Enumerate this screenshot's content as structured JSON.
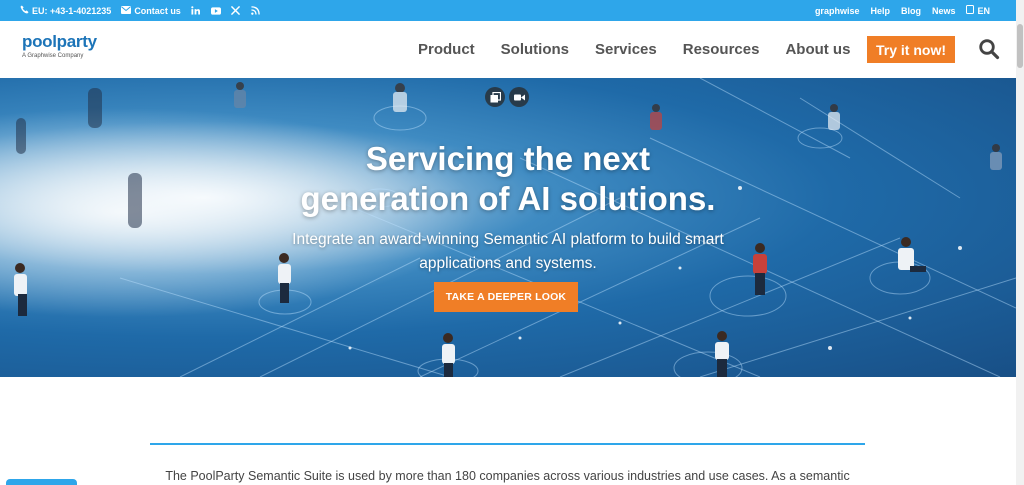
{
  "topbar": {
    "phone_label": "EU: +43-1-4021235",
    "contact_label": "Contact us",
    "right_links": [
      "graphwise",
      "Help",
      "Blog",
      "News"
    ],
    "language": "EN",
    "bg_color": "#2ea6ea"
  },
  "header": {
    "logo_text": "poolparty",
    "logo_subtitle": "A Graphwise Company",
    "nav": [
      "Product",
      "Solutions",
      "Services",
      "Resources",
      "About us"
    ],
    "cta_label": "Try it now!",
    "accent_color": "#f07e26"
  },
  "hero": {
    "title_line1": "Servicing the next",
    "title_line2": "generation of AI solutions.",
    "subtitle_line1": "Integrate an award-winning Semantic AI platform to build smart",
    "subtitle_line2": "applications and systems.",
    "button_label": "TAKE A DEEPER LOOK"
  },
  "intro": {
    "text": "The PoolParty Semantic Suite is used by more than 180 companies across various industries and use cases. As a semantic"
  }
}
